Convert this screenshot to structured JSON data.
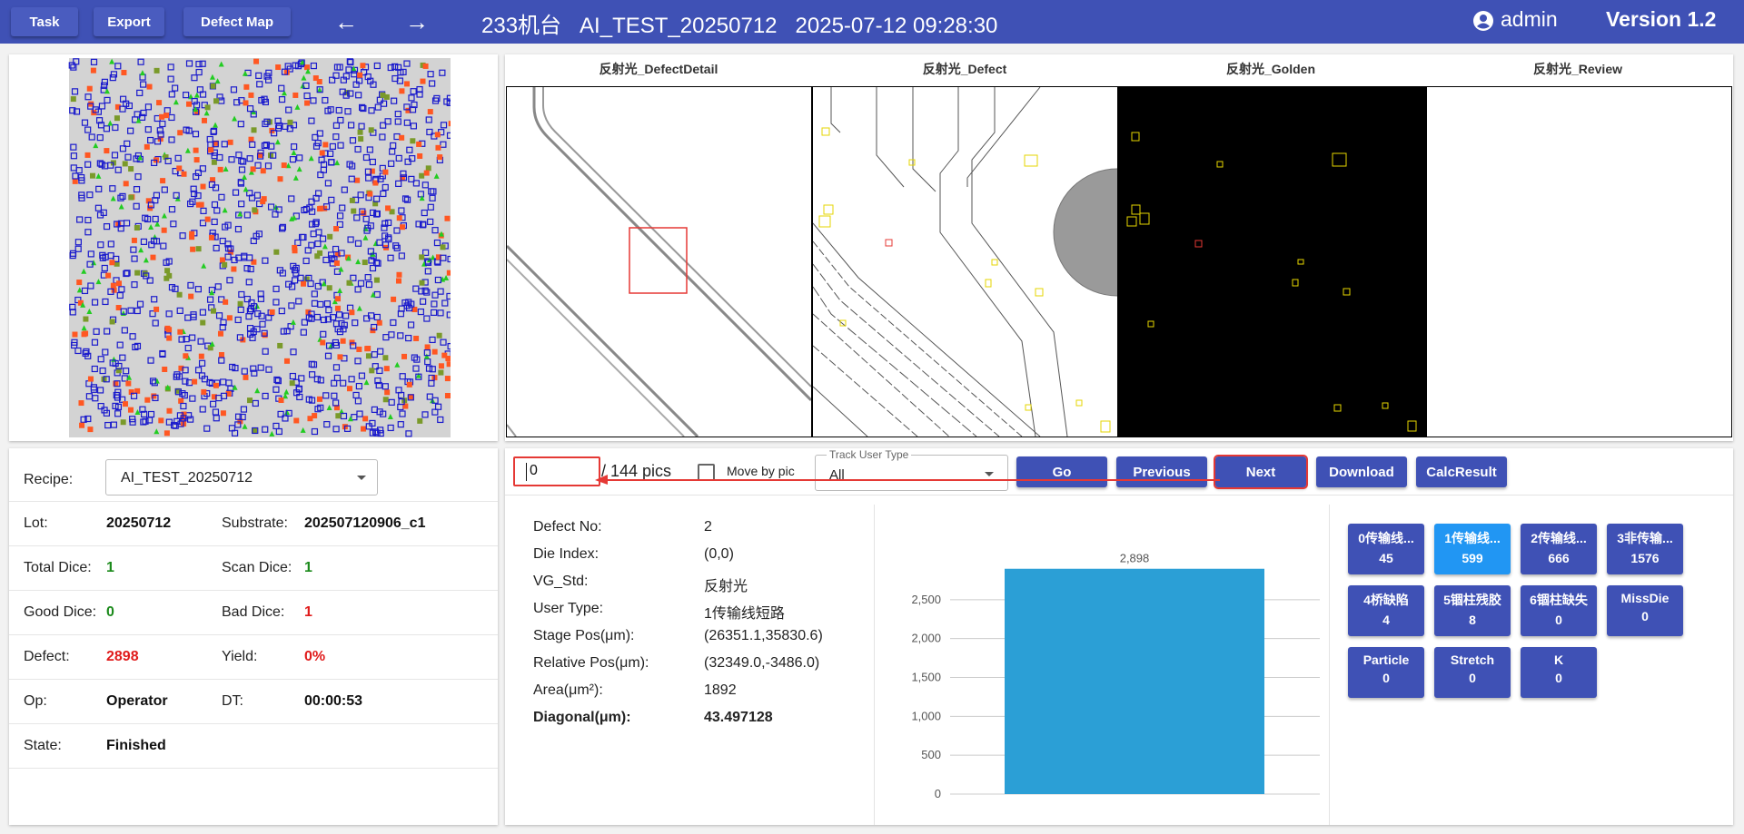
{
  "topbar": {
    "task": "Task",
    "export": "Export",
    "defect_map": "Defect Map",
    "title": "233机台   AI_TEST_20250712   2025-07-12 09:28:30",
    "user": "admin",
    "version": "Version 1.2"
  },
  "images": [
    "反射光_DefectDetail",
    "反射光_Defect",
    "反射光_Golden",
    "反射光_Review"
  ],
  "lot_info": {
    "recipe_label": "Recipe:",
    "recipe_value": "AI_TEST_20250712",
    "lot_label": "Lot:",
    "lot": "20250712",
    "substrate_label": "Substrate:",
    "substrate": "202507120906_c1",
    "total_dice_label": "Total Dice:",
    "total_dice": "1",
    "scan_dice_label": "Scan Dice:",
    "scan_dice": "1",
    "good_dice_label": "Good Dice:",
    "good_dice": "0",
    "bad_dice_label": "Bad Dice:",
    "bad_dice": "1",
    "defect_label": "Defect:",
    "defect": "2898",
    "yield_label": "Yield:",
    "yield": "0%",
    "op_label": "Op:",
    "op": "Operator",
    "dt_label": "DT:",
    "dt": "00:00:53",
    "state_label": "State:",
    "state": "Finished"
  },
  "controls": {
    "pic_index": "0",
    "pic_total": "/ 144 pics",
    "move_by_pic": "Move by pic",
    "track_user_type_label": "Track User Type",
    "track_user_type_value": "All",
    "go": "Go",
    "previous": "Previous",
    "next": "Next",
    "download": "Download",
    "calc_result": "CalcResult"
  },
  "defect": [
    {
      "label": "Defect No:",
      "value": "2"
    },
    {
      "label": "Die Index:",
      "value": "(0,0)"
    },
    {
      "label": "VG_Std:",
      "value": "反射光"
    },
    {
      "label": "User Type:",
      "value": "1传输线短路"
    },
    {
      "label": "Stage Pos(μm):",
      "value": "(26351.1,35830.6)"
    },
    {
      "label": "Relative Pos(μm):",
      "value": "(32349.0,-3486.0)"
    },
    {
      "label": "Area(μm²):",
      "value": "1892"
    },
    {
      "label": "Diagonal(μm):",
      "value": "43.497128"
    }
  ],
  "chart_data": {
    "type": "bar",
    "categories": [
      ""
    ],
    "values": [
      2898
    ],
    "value_labels": [
      "2,898"
    ],
    "yticks": [
      "0",
      "500",
      "1,000",
      "1,500",
      "2,000",
      "2,500"
    ],
    "ylim": [
      0,
      3000
    ],
    "color": "#2b9fd6",
    "grid": true
  },
  "categories": [
    {
      "name": "0传输线...",
      "count": "45"
    },
    {
      "name": "1传输线...",
      "count": "599",
      "selected": true
    },
    {
      "name": "2传输线...",
      "count": "666"
    },
    {
      "name": "3非传输...",
      "count": "1576"
    },
    {
      "name": "4桥缺陷",
      "count": "4"
    },
    {
      "name": "5锢柱残胶",
      "count": "8"
    },
    {
      "name": "6锢柱缺失",
      "count": "0"
    },
    {
      "name": "MissDie",
      "count": "0"
    },
    {
      "name": "Particle",
      "count": "0"
    },
    {
      "name": "Stretch",
      "count": "0"
    },
    {
      "name": "K",
      "count": "0"
    }
  ],
  "colors": {
    "primary": "#3f51b5",
    "selected": "#2196f3",
    "red": "#e01b1b",
    "green": "#1b8a1b",
    "bar": "#2b9fd6"
  }
}
